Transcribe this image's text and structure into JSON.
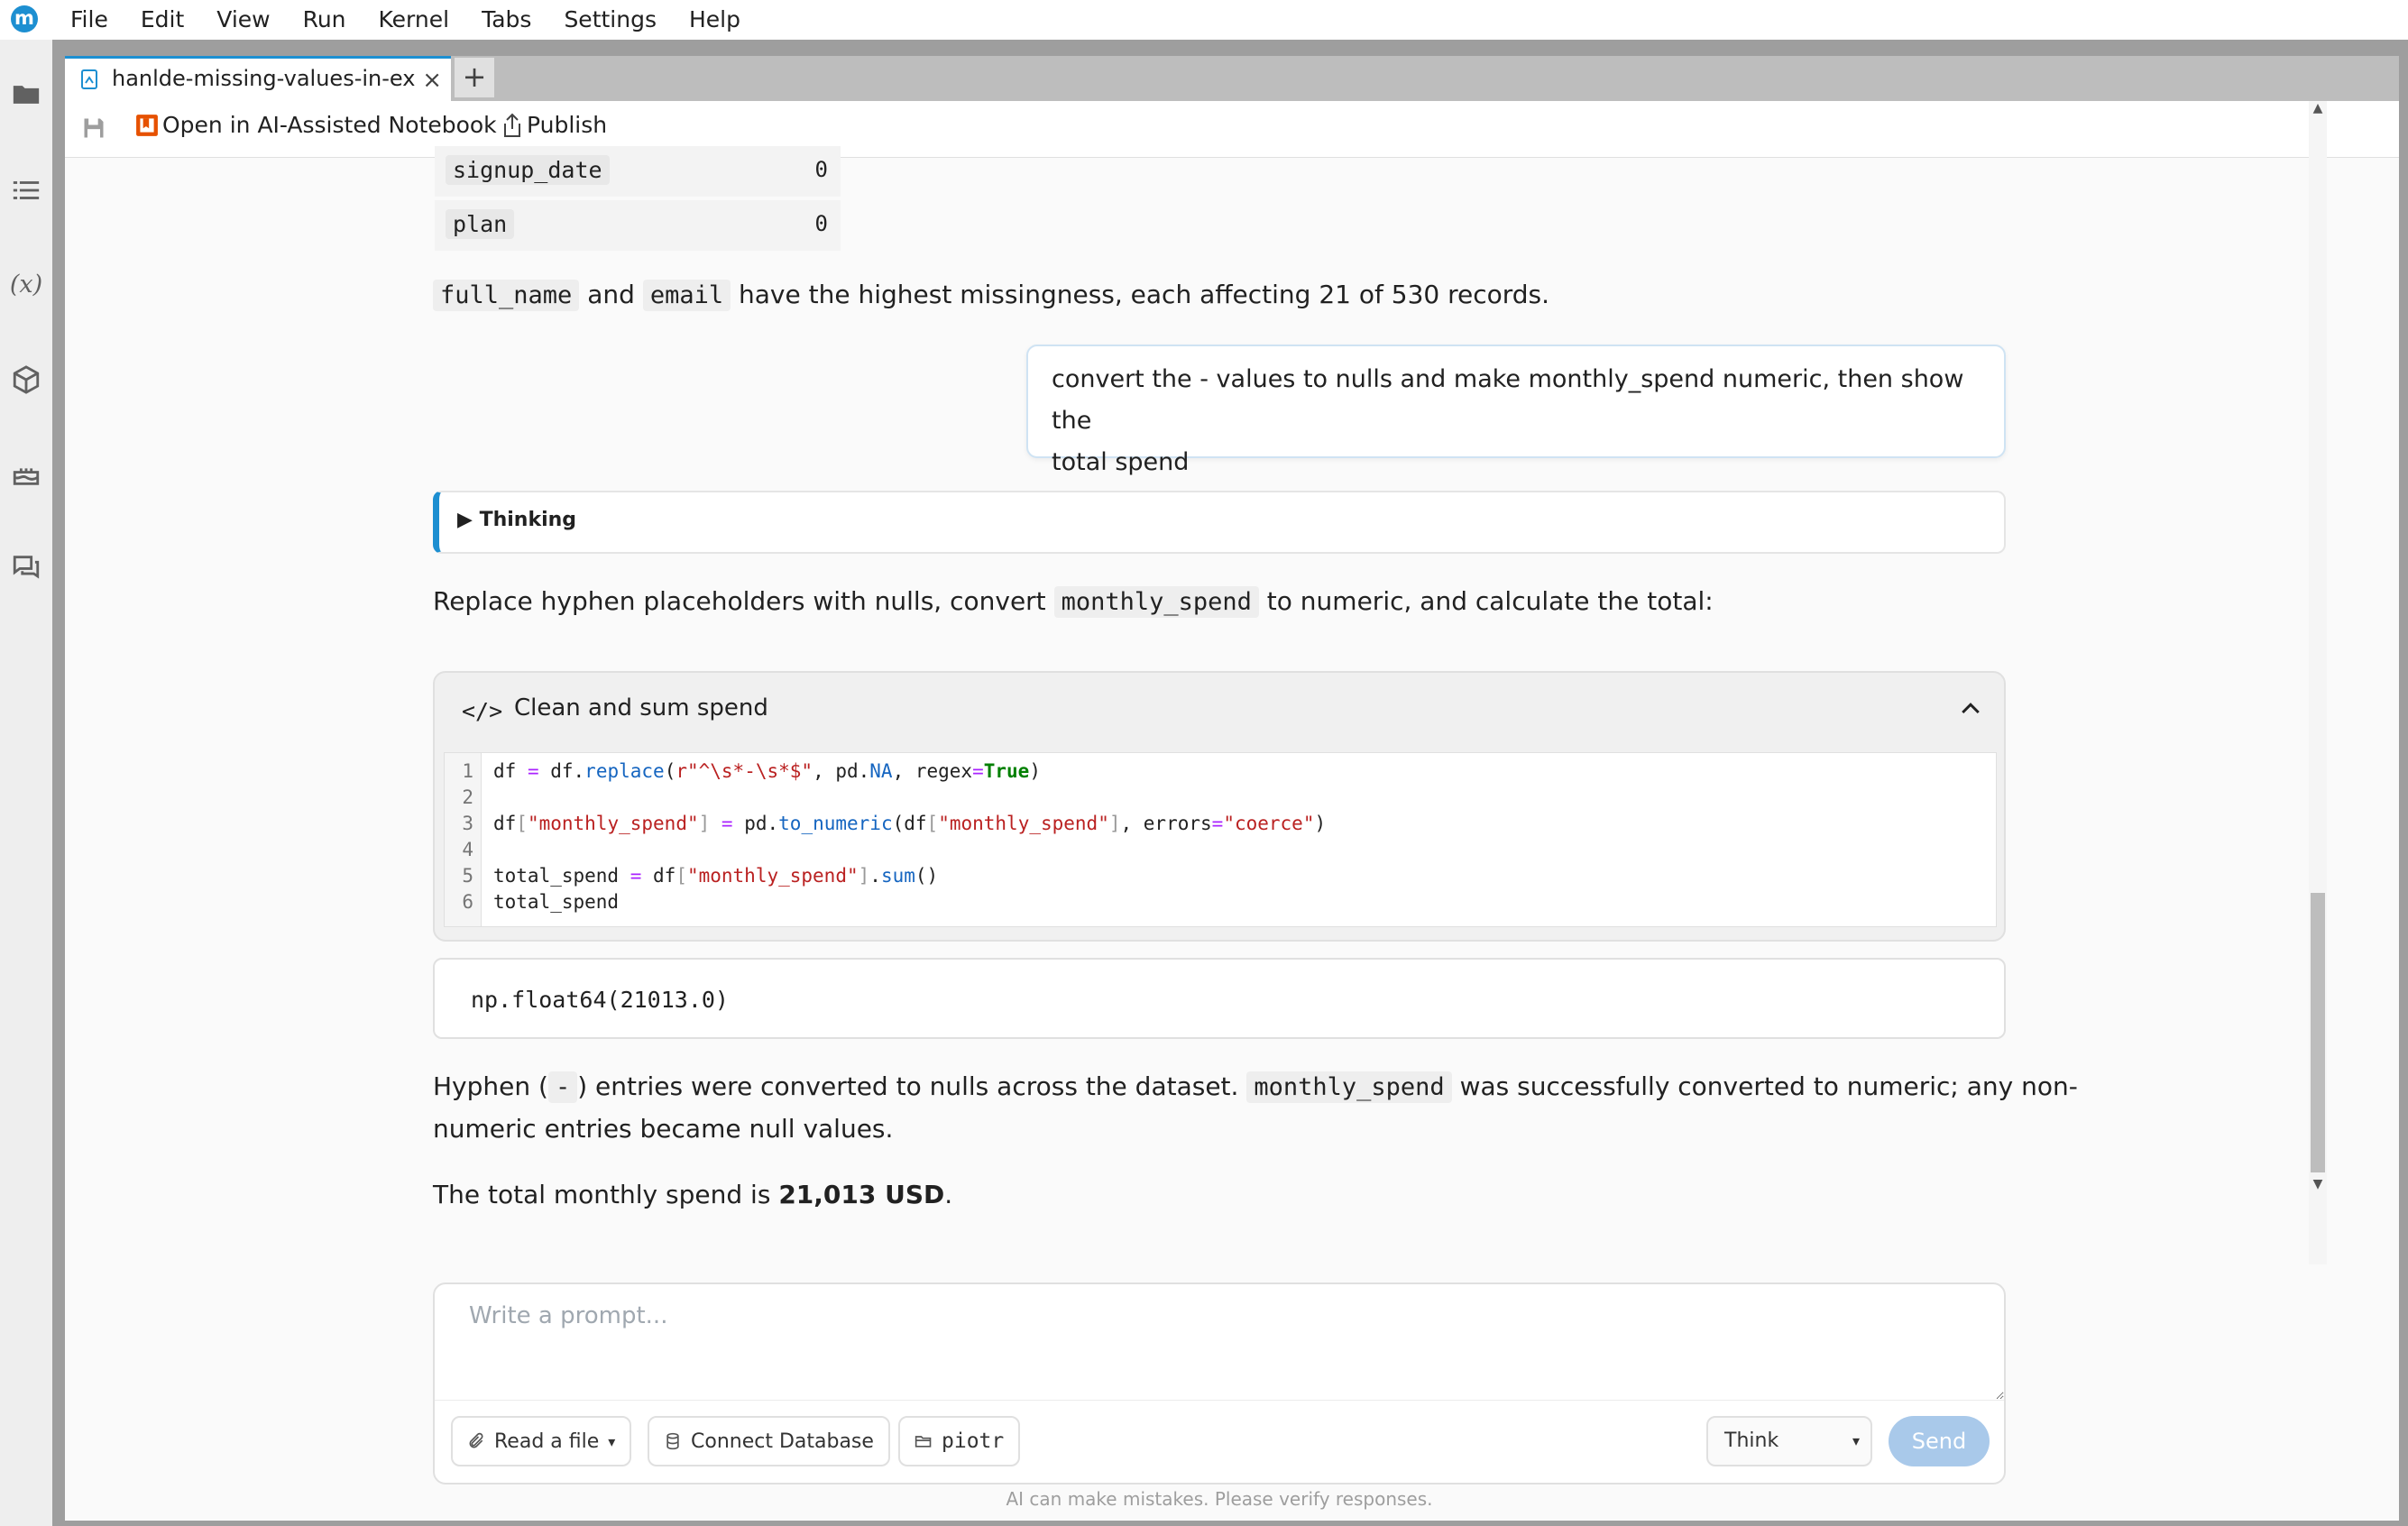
{
  "menubar": {
    "logo": "m",
    "items": [
      "File",
      "Edit",
      "View",
      "Run",
      "Kernel",
      "Tabs",
      "Settings",
      "Help"
    ]
  },
  "tab": {
    "title": "hanlde-missing-values-in-exc",
    "close": "×",
    "add": "+"
  },
  "toolbar": {
    "ai_label": "Open in AI-Assisted Notebook",
    "publish_label": "Publish"
  },
  "table_rows": [
    {
      "key": "signup_date",
      "value": "0"
    },
    {
      "key": "plan",
      "value": "0"
    }
  ],
  "para1": {
    "code1": "full_name",
    "and": "and",
    "code2": "email",
    "rest": "have the highest missingness, each affecting 21 of 530 records."
  },
  "user_message": {
    "line1": "convert the - values to nulls and make monthly_spend numeric, then show the",
    "line2": "total spend"
  },
  "thinking_label": "▶ Thinking",
  "para2": {
    "pre": "Replace hyphen placeholders with nulls, convert",
    "code": "monthly_spend",
    "post": "to numeric, and calculate the total:"
  },
  "code_cell": {
    "icon": "</>",
    "title": "Clean and sum spend",
    "line_numbers": [
      "1",
      "2",
      "3",
      "4",
      "5",
      "6"
    ]
  },
  "output_value": "np.float64(21013.0)",
  "para3": {
    "pre": "Hyphen (",
    "code1": "-",
    "mid": ") entries were converted to nulls across the dataset.",
    "code2": "monthly_spend",
    "post": "was successfully converted to numeric; any non-",
    "line2": "numeric entries became null values."
  },
  "para4": {
    "pre": "The total monthly spend is",
    "bold": "21,013 USD",
    "post": "."
  },
  "prompt": {
    "placeholder": "Write a prompt...",
    "read_file": "Read a file",
    "caret": "▾",
    "connect_db": "Connect Database",
    "folder": "piotr",
    "mode": "Think",
    "send": "Send"
  },
  "disclaimer": "AI can make mistakes. Please verify responses.",
  "colors": {
    "accent": "#1d8fd1",
    "send_disabled": "#a9c9ea",
    "string": "#ba2121",
    "function": "#1565c0",
    "keyword": "#008000"
  }
}
